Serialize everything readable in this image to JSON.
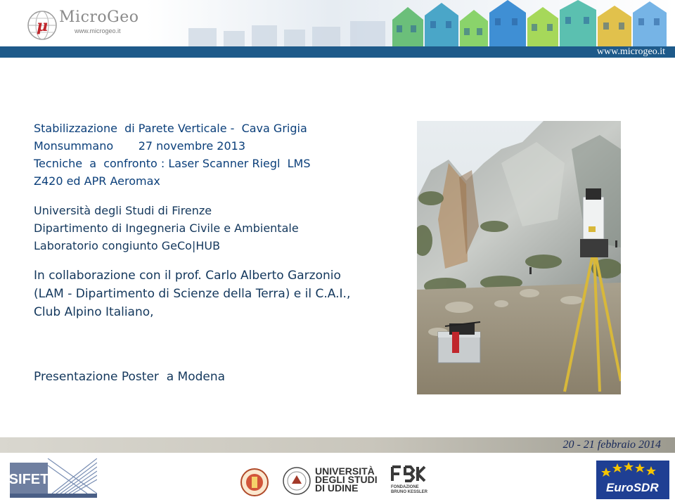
{
  "header": {
    "logo_name": "MicroGeo",
    "logo_url": "www.microgeo.it",
    "url": "www.microgeo.it",
    "bar_color": "#1e5a8a"
  },
  "main": {
    "title_lines": [
      "Stabilizzazione  di Parete Verticale -  Cava Grigia",
      "Monsummano       27 novembre 2013",
      "Tecniche  a  confronto : Laser Scanner Riegl  LMS",
      "Z420 ed APR Aeromax"
    ],
    "institution_lines": [
      "Università degli Studi di Firenze",
      "Dipartimento di Ingegneria Civile e Ambientale",
      "Laboratorio congiunto GeCo|HUB"
    ],
    "collaboration_lines": [
      "In collaborazione con il prof. Carlo Alberto Garzonio",
      "(LAM - Dipartimento di Scienze della Terra) e il C.A.I.,",
      "Club Alpino Italiano,"
    ],
    "presentation": "Presentazione Poster  a Modena",
    "text_color": "#13375c"
  },
  "footer": {
    "date": "20  - 21   febbraio  2014",
    "logos": {
      "sifet": "SIFET",
      "udine": [
        "UNIVERSITÀ",
        "DEGLI STUDI",
        "DI UDINE"
      ],
      "fbk": [
        "FONDAZIONE",
        "BRUNO KESSLER"
      ],
      "eurosdr": "EuroSDR"
    }
  }
}
